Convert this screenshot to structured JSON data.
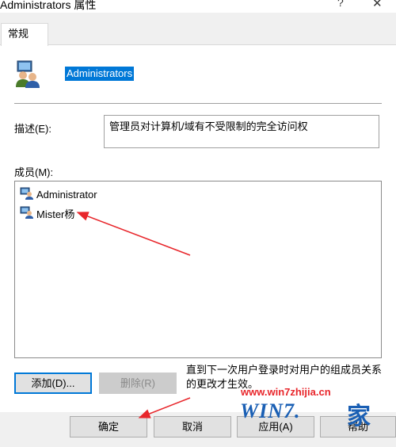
{
  "window": {
    "title": "Administrators 属性",
    "help_glyph": "?",
    "close_glyph": "✕"
  },
  "tabs": [
    {
      "label": "常规",
      "active": true
    }
  ],
  "group": {
    "name": "Administrators",
    "icon": "user-group-icon"
  },
  "description": {
    "label": "描述(E):",
    "value": "管理员对计算机/域有不受限制的完全访问权"
  },
  "members": {
    "label": "成员(M):",
    "items": [
      {
        "name": "Administrator",
        "icon": "user-icon"
      },
      {
        "name": "Mister杨",
        "icon": "user-icon"
      }
    ]
  },
  "buttons": {
    "add": "添加(D)...",
    "remove": "删除(R)",
    "ok": "确定",
    "cancel": "取消",
    "apply": "应用(A)",
    "help": "帮助"
  },
  "annotation": {
    "text": "直到下一次用户登录时对用户的组成员关系的更改才生效。",
    "arrow_color": "#e8262b"
  },
  "watermark": {
    "url": "www.win7zhijia.cn",
    "logo_text": "WIN7.",
    "suffix": "家"
  },
  "colors": {
    "selection": "#0078d7",
    "focus_border": "#0078d7",
    "watermark_red": "#e8262b",
    "watermark_blue": "#1a5fb4"
  }
}
